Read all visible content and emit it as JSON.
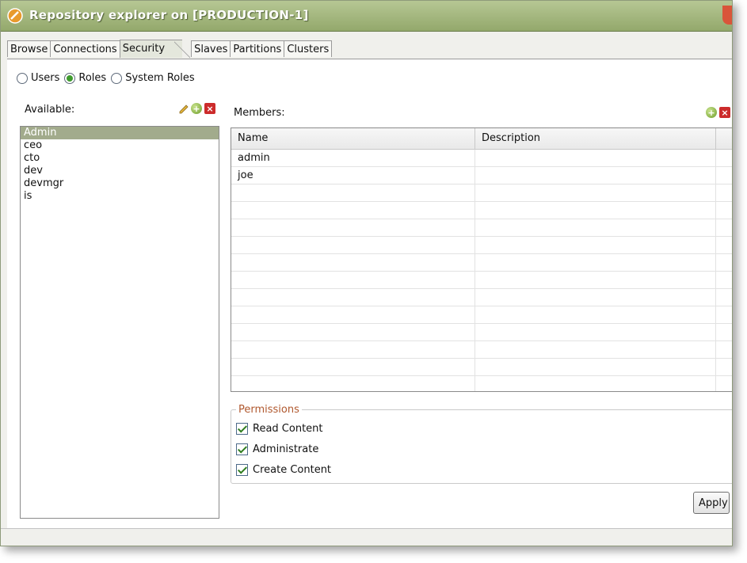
{
  "window": {
    "title": "Repository explorer on [PRODUCTION-1]"
  },
  "tabs": [
    {
      "label": "Browse"
    },
    {
      "label": "Connections"
    },
    {
      "label": "Security"
    },
    {
      "label": "Slaves"
    },
    {
      "label": "Partitions"
    },
    {
      "label": "Clusters"
    }
  ],
  "active_tab": "Security",
  "mode": {
    "options": [
      {
        "label": "Users",
        "checked": false
      },
      {
        "label": "Roles",
        "checked": true
      },
      {
        "label": "System Roles",
        "checked": false
      }
    ]
  },
  "available": {
    "label": "Available:",
    "items": [
      {
        "label": "Admin",
        "selected": true
      },
      {
        "label": "ceo",
        "selected": false
      },
      {
        "label": "cto",
        "selected": false
      },
      {
        "label": "dev",
        "selected": false
      },
      {
        "label": "devmgr",
        "selected": false
      },
      {
        "label": "is",
        "selected": false
      }
    ],
    "icons": [
      "pencil-icon",
      "add-icon",
      "delete-icon"
    ]
  },
  "members": {
    "label": "Members:",
    "columns": [
      "Name",
      "Description"
    ],
    "rows": [
      {
        "name": "admin",
        "description": ""
      },
      {
        "name": "joe",
        "description": ""
      }
    ],
    "icons": [
      "add-icon",
      "delete-icon"
    ]
  },
  "permissions": {
    "title": "Permissions",
    "items": [
      {
        "label": "Read Content",
        "checked": true
      },
      {
        "label": "Administrate",
        "checked": true
      },
      {
        "label": "Create Content",
        "checked": true
      }
    ]
  },
  "buttons": {
    "apply": "Apply"
  },
  "colors": {
    "titlebar": "#9fb27a",
    "selection": "#a2ab8c",
    "radio_checked": "#3f9b2e",
    "permissions_title": "#b0582e"
  }
}
